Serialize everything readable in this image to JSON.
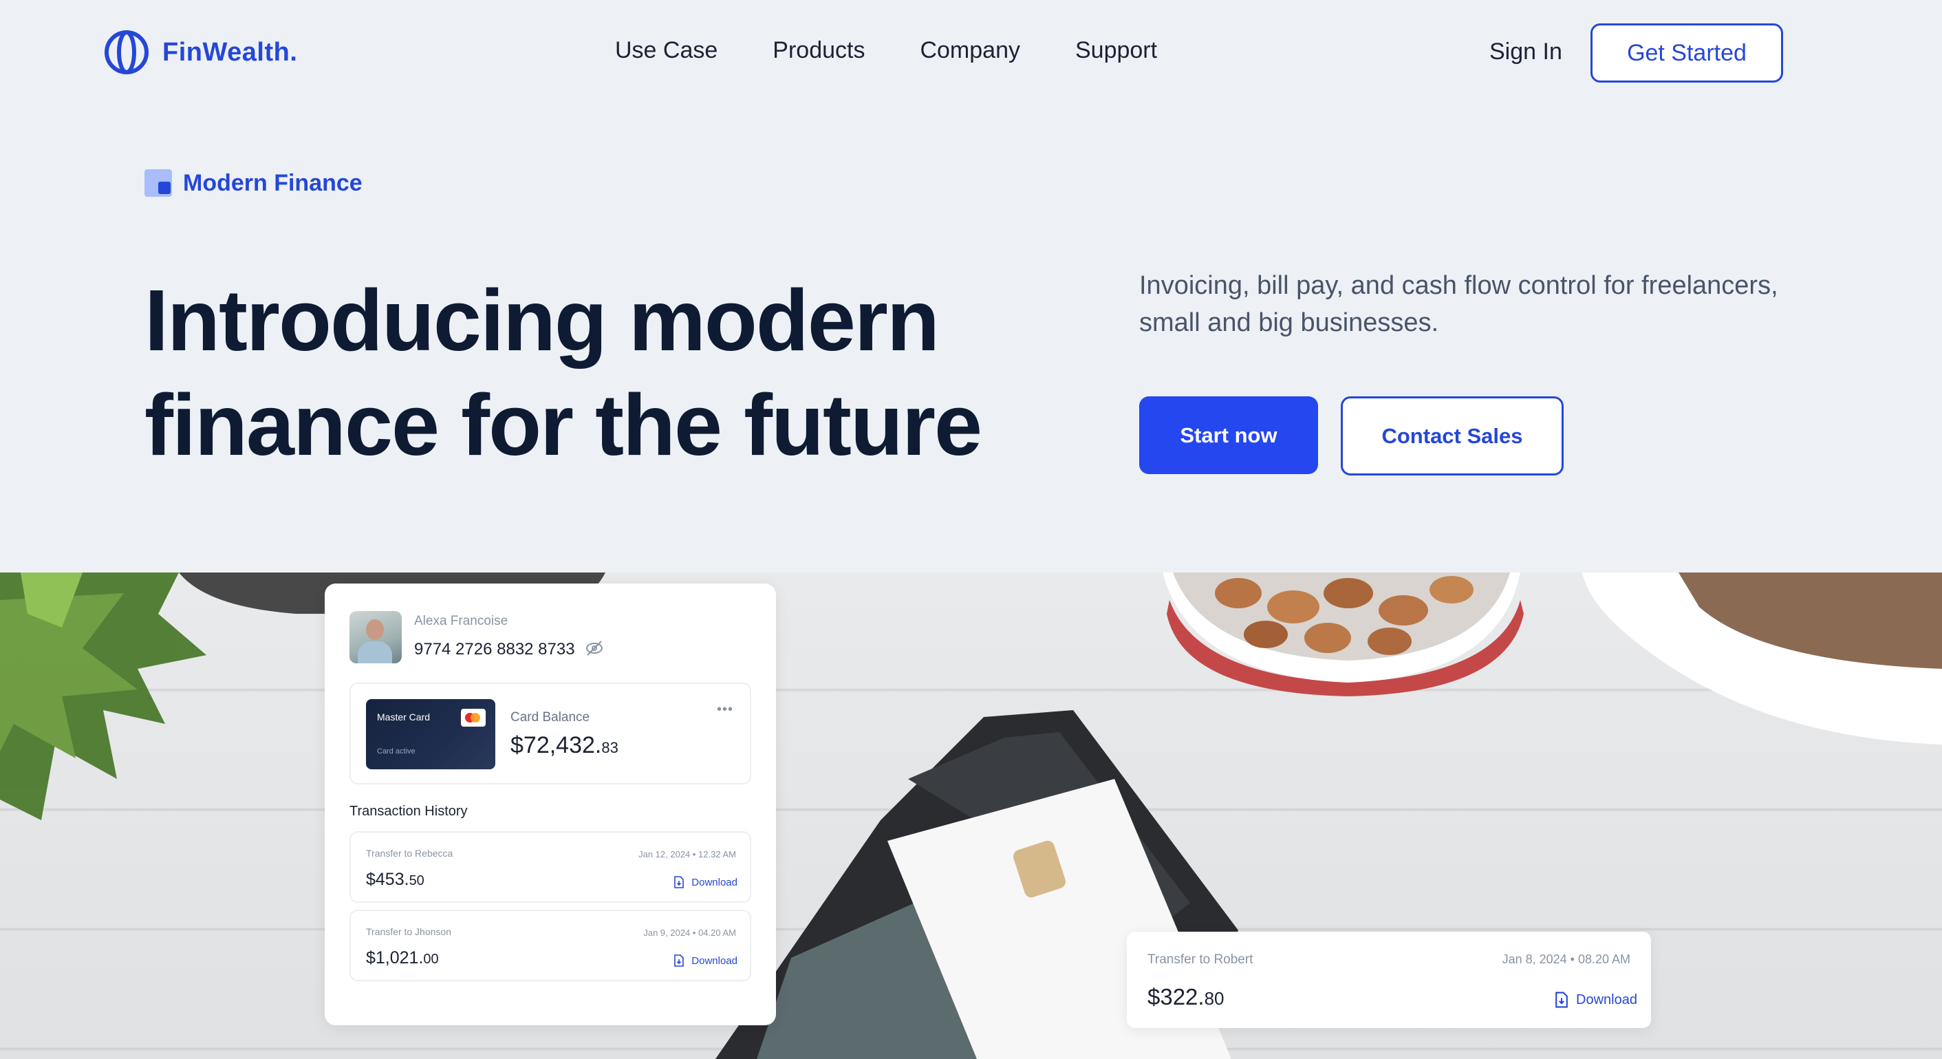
{
  "brand": {
    "name": "FinWealth.",
    "color": "#2547d8"
  },
  "nav": {
    "items": [
      "Use Case",
      "Products",
      "Company",
      "Support"
    ],
    "sign_in": "Sign In",
    "get_started": "Get Started"
  },
  "hero": {
    "tag": "Modern Finance",
    "headline_line1": "Introducing modern",
    "headline_line2": "finance for the future",
    "subtext": "Invoicing, bill pay, and cash flow control for freelancers, small and big businesses.",
    "primary_cta": "Start now",
    "secondary_cta": "Contact Sales"
  },
  "account_card": {
    "user_name": "Alexa Francoise",
    "card_number": "9774 2726 8832 8733",
    "mini_card_title": "Master Card",
    "mini_card_status": "Card active",
    "balance_label": "Card Balance",
    "balance_main": "$72,432.",
    "balance_cents": "83",
    "history_title": "Transaction History",
    "transactions": [
      {
        "label": "Transfer to Rebecca",
        "date": "Jan 12, 2024 • 12.32 AM",
        "amount_main": "$453.",
        "amount_cents": "50",
        "download": "Download"
      },
      {
        "label": "Transfer to Jhonson",
        "date": "Jan 9, 2024 • 04.20 AM",
        "amount_main": "$1,021.",
        "amount_cents": "00",
        "download": "Download"
      }
    ]
  },
  "floating_transaction": {
    "label": "Transfer to Robert",
    "date": "Jan 8, 2024 • 08.20 AM",
    "amount_main": "$322.",
    "amount_cents": "80",
    "download": "Download"
  },
  "colors": {
    "accent": "#2547ef",
    "background": "#edf1f6",
    "text_dark": "#0f1b33"
  }
}
